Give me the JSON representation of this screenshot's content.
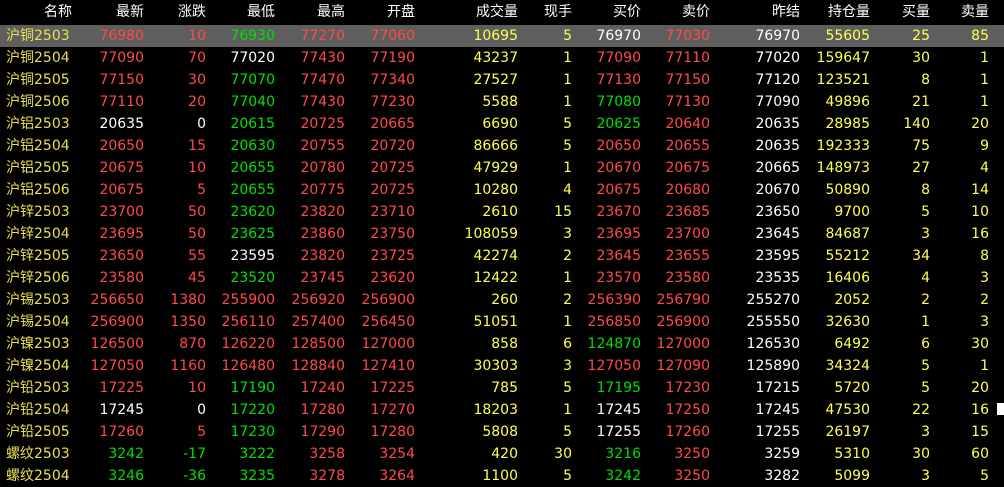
{
  "colors": {
    "up": "#ff4a4a",
    "down": "#00e000",
    "flat": "#ffffff",
    "volume": "#ffff54",
    "name": "#e8e050",
    "background": "#000000",
    "selected_row": "#5e5e5e"
  },
  "header": [
    "名称",
    "最新",
    "涨跌",
    "最低",
    "最高",
    "开盘",
    "成交量",
    "现手",
    "买价",
    "卖价",
    "昨结",
    "持仓量",
    "买量",
    "卖量"
  ],
  "selected_row_index": 0,
  "rows": [
    {
      "cells": [
        "沪铜2503",
        "76980",
        "10",
        "76930",
        "77270",
        "77060",
        "10695",
        "5",
        "76970",
        "77030",
        "76970",
        "55605",
        "25",
        "85"
      ],
      "colors": [
        "name",
        "red",
        "red",
        "green",
        "red",
        "red",
        "yellow",
        "yellow",
        "white",
        "red",
        "white",
        "yellow",
        "yellow",
        "yellow"
      ]
    },
    {
      "cells": [
        "沪铜2504",
        "77090",
        "70",
        "77020",
        "77430",
        "77190",
        "43237",
        "1",
        "77090",
        "77110",
        "77020",
        "159647",
        "30",
        "1"
      ],
      "colors": [
        "name",
        "red",
        "red",
        "white",
        "red",
        "red",
        "yellow",
        "yellow",
        "red",
        "red",
        "white",
        "yellow",
        "yellow",
        "yellow"
      ]
    },
    {
      "cells": [
        "沪铜2505",
        "77150",
        "30",
        "77070",
        "77470",
        "77340",
        "27527",
        "1",
        "77130",
        "77150",
        "77120",
        "123521",
        "8",
        "1"
      ],
      "colors": [
        "name",
        "red",
        "red",
        "green",
        "red",
        "red",
        "yellow",
        "yellow",
        "red",
        "red",
        "white",
        "yellow",
        "yellow",
        "yellow"
      ]
    },
    {
      "cells": [
        "沪铜2506",
        "77110",
        "20",
        "77040",
        "77430",
        "77230",
        "5588",
        "1",
        "77080",
        "77130",
        "77090",
        "49896",
        "21",
        "1"
      ],
      "colors": [
        "name",
        "red",
        "red",
        "green",
        "red",
        "red",
        "yellow",
        "yellow",
        "green",
        "red",
        "white",
        "yellow",
        "yellow",
        "yellow"
      ]
    },
    {
      "cells": [
        "沪铝2503",
        "20635",
        "0",
        "20615",
        "20725",
        "20665",
        "6690",
        "5",
        "20625",
        "20640",
        "20635",
        "28985",
        "140",
        "20"
      ],
      "colors": [
        "name",
        "white",
        "white",
        "green",
        "red",
        "red",
        "yellow",
        "yellow",
        "green",
        "red",
        "white",
        "yellow",
        "yellow",
        "yellow"
      ]
    },
    {
      "cells": [
        "沪铝2504",
        "20650",
        "15",
        "20630",
        "20755",
        "20720",
        "86666",
        "5",
        "20650",
        "20655",
        "20635",
        "192333",
        "75",
        "9"
      ],
      "colors": [
        "name",
        "red",
        "red",
        "green",
        "red",
        "red",
        "yellow",
        "yellow",
        "red",
        "red",
        "white",
        "yellow",
        "yellow",
        "yellow"
      ]
    },
    {
      "cells": [
        "沪铝2505",
        "20675",
        "10",
        "20655",
        "20780",
        "20725",
        "47929",
        "1",
        "20670",
        "20675",
        "20665",
        "148973",
        "27",
        "4"
      ],
      "colors": [
        "name",
        "red",
        "red",
        "green",
        "red",
        "red",
        "yellow",
        "yellow",
        "red",
        "red",
        "white",
        "yellow",
        "yellow",
        "yellow"
      ]
    },
    {
      "cells": [
        "沪铝2506",
        "20675",
        "5",
        "20655",
        "20775",
        "20725",
        "10280",
        "4",
        "20675",
        "20680",
        "20670",
        "50890",
        "8",
        "14"
      ],
      "colors": [
        "name",
        "red",
        "red",
        "green",
        "red",
        "red",
        "yellow",
        "yellow",
        "red",
        "red",
        "white",
        "yellow",
        "yellow",
        "yellow"
      ]
    },
    {
      "cells": [
        "沪锌2503",
        "23700",
        "50",
        "23620",
        "23820",
        "23710",
        "2610",
        "15",
        "23670",
        "23685",
        "23650",
        "9700",
        "5",
        "10"
      ],
      "colors": [
        "name",
        "red",
        "red",
        "green",
        "red",
        "red",
        "yellow",
        "yellow",
        "red",
        "red",
        "white",
        "yellow",
        "yellow",
        "yellow"
      ]
    },
    {
      "cells": [
        "沪锌2504",
        "23695",
        "50",
        "23625",
        "23860",
        "23750",
        "108059",
        "3",
        "23695",
        "23700",
        "23645",
        "84687",
        "3",
        "16"
      ],
      "colors": [
        "name",
        "red",
        "red",
        "green",
        "red",
        "red",
        "yellow",
        "yellow",
        "red",
        "red",
        "white",
        "yellow",
        "yellow",
        "yellow"
      ]
    },
    {
      "cells": [
        "沪锌2505",
        "23650",
        "55",
        "23595",
        "23820",
        "23725",
        "42274",
        "2",
        "23645",
        "23655",
        "23595",
        "55212",
        "34",
        "8"
      ],
      "colors": [
        "name",
        "red",
        "red",
        "white",
        "red",
        "red",
        "yellow",
        "yellow",
        "red",
        "red",
        "white",
        "yellow",
        "yellow",
        "yellow"
      ]
    },
    {
      "cells": [
        "沪锌2506",
        "23580",
        "45",
        "23520",
        "23745",
        "23620",
        "12422",
        "1",
        "23570",
        "23580",
        "23535",
        "16406",
        "4",
        "3"
      ],
      "colors": [
        "name",
        "red",
        "red",
        "green",
        "red",
        "red",
        "yellow",
        "yellow",
        "red",
        "red",
        "white",
        "yellow",
        "yellow",
        "yellow"
      ]
    },
    {
      "cells": [
        "沪锡2503",
        "256650",
        "1380",
        "255900",
        "256920",
        "256900",
        "260",
        "2",
        "256390",
        "256790",
        "255270",
        "2052",
        "2",
        "2"
      ],
      "colors": [
        "name",
        "red",
        "red",
        "red",
        "red",
        "red",
        "yellow",
        "yellow",
        "red",
        "red",
        "white",
        "yellow",
        "yellow",
        "yellow"
      ]
    },
    {
      "cells": [
        "沪锡2504",
        "256900",
        "1350",
        "256110",
        "257400",
        "256450",
        "51051",
        "1",
        "256850",
        "256900",
        "255550",
        "32630",
        "1",
        "3"
      ],
      "colors": [
        "name",
        "red",
        "red",
        "red",
        "red",
        "red",
        "yellow",
        "yellow",
        "red",
        "red",
        "white",
        "yellow",
        "yellow",
        "yellow"
      ]
    },
    {
      "cells": [
        "沪镍2503",
        "126500",
        "870",
        "126220",
        "128500",
        "127000",
        "858",
        "6",
        "124870",
        "127000",
        "126530",
        "6492",
        "6",
        "30"
      ],
      "colors": [
        "name",
        "red",
        "red",
        "red",
        "red",
        "red",
        "yellow",
        "yellow",
        "green",
        "red",
        "white",
        "yellow",
        "yellow",
        "yellow"
      ]
    },
    {
      "cells": [
        "沪镍2504",
        "127050",
        "1160",
        "126480",
        "128840",
        "127410",
        "30303",
        "3",
        "127050",
        "127090",
        "125890",
        "34324",
        "5",
        "1"
      ],
      "colors": [
        "name",
        "red",
        "red",
        "red",
        "red",
        "red",
        "yellow",
        "yellow",
        "red",
        "red",
        "white",
        "yellow",
        "yellow",
        "yellow"
      ]
    },
    {
      "cells": [
        "沪铅2503",
        "17225",
        "10",
        "17190",
        "17240",
        "17225",
        "785",
        "5",
        "17195",
        "17230",
        "17215",
        "5720",
        "5",
        "20"
      ],
      "colors": [
        "name",
        "red",
        "red",
        "green",
        "red",
        "red",
        "yellow",
        "yellow",
        "green",
        "red",
        "white",
        "yellow",
        "yellow",
        "yellow"
      ]
    },
    {
      "cells": [
        "沪铅2504",
        "17245",
        "0",
        "17220",
        "17280",
        "17270",
        "18203",
        "1",
        "17245",
        "17250",
        "17245",
        "47530",
        "22",
        "16"
      ],
      "colors": [
        "name",
        "white",
        "white",
        "green",
        "red",
        "red",
        "yellow",
        "yellow",
        "white",
        "red",
        "white",
        "yellow",
        "yellow",
        "yellow"
      ]
    },
    {
      "cells": [
        "沪铅2505",
        "17260",
        "5",
        "17230",
        "17290",
        "17280",
        "5808",
        "5",
        "17255",
        "17260",
        "17255",
        "26197",
        "3",
        "15"
      ],
      "colors": [
        "name",
        "red",
        "red",
        "green",
        "red",
        "red",
        "yellow",
        "yellow",
        "white",
        "red",
        "white",
        "yellow",
        "yellow",
        "yellow"
      ]
    },
    {
      "cells": [
        "螺纹2503",
        "3242",
        "-17",
        "3222",
        "3258",
        "3254",
        "420",
        "30",
        "3216",
        "3250",
        "3259",
        "5310",
        "30",
        "60"
      ],
      "colors": [
        "name",
        "green",
        "green",
        "green",
        "red",
        "red",
        "yellow",
        "yellow",
        "green",
        "red",
        "white",
        "yellow",
        "yellow",
        "yellow"
      ]
    },
    {
      "cells": [
        "螺纹2504",
        "3246",
        "-36",
        "3235",
        "3278",
        "3264",
        "1100",
        "5",
        "3242",
        "3250",
        "3282",
        "5099",
        "3",
        "5"
      ],
      "colors": [
        "name",
        "green",
        "green",
        "green",
        "red",
        "red",
        "yellow",
        "yellow",
        "green",
        "red",
        "white",
        "yellow",
        "yellow",
        "yellow"
      ]
    }
  ]
}
